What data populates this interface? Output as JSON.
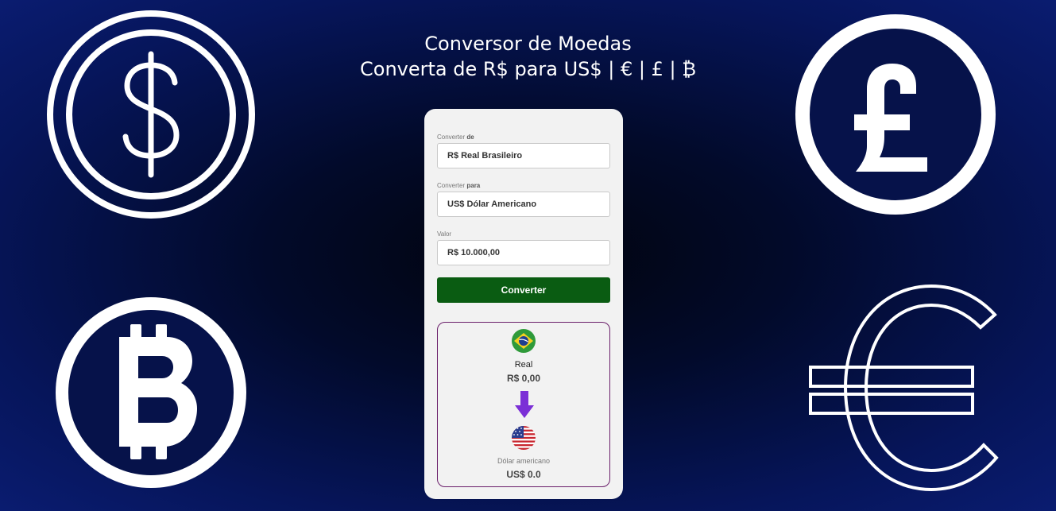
{
  "header": {
    "title": "Conversor de Moedas",
    "subtitle": "Converta de R$ para US$ | € | £ | ₿"
  },
  "form": {
    "from_label_prefix": "Converter",
    "from_label_bold": "de",
    "from_value": "R$ Real Brasileiro",
    "to_label_prefix": "Converter",
    "to_label_bold": "para",
    "to_value": "US$ Dólar Americano",
    "amount_label": "Valor",
    "amount_value": "R$ 10.000,00",
    "convert_button": "Converter"
  },
  "result": {
    "source_currency_name": "Real",
    "source_value": "R$ 0,00",
    "target_currency_name": "Dólar americano",
    "target_value": "US$ 0.0"
  },
  "colors": {
    "button_green": "#0a5c12",
    "arrow_purple": "#7b2fd6",
    "result_border": "#6b1f6b"
  }
}
